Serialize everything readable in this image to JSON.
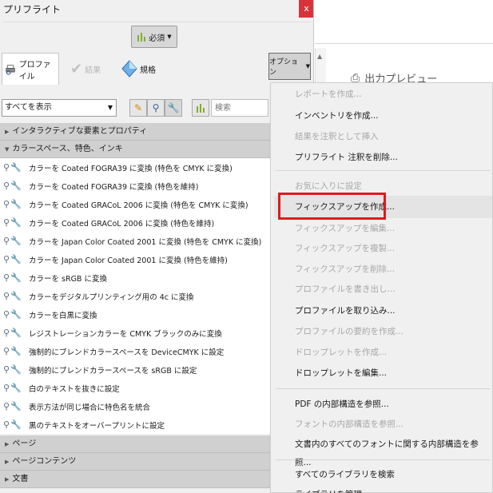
{
  "window": {
    "title": "プリフライト",
    "close_label": "x"
  },
  "toolbar_top": {
    "required_label": "必須"
  },
  "tabs": [
    {
      "label": "プロファイル",
      "icon": "printer-icon",
      "state": "active"
    },
    {
      "label": "結果",
      "icon": "check-icon",
      "state": "disabled"
    },
    {
      "label": "規格",
      "icon": "diamond-icon",
      "state": "normal"
    }
  ],
  "options_label": "オプション",
  "filter": {
    "selected": "すべてを表示"
  },
  "search": {
    "placeholder": "検索"
  },
  "categories": {
    "interactive": "インタラクティブな要素とプロパティ",
    "colorspace": "カラースペース、特色、インキ",
    "page": "ページ",
    "page_contents": "ページコンテンツ",
    "document": "文書"
  },
  "profiles": [
    "カラーを Coated FOGRA39 に変換 (特色を CMYK に変換)",
    "カラーを Coated FOGRA39 に変換 (特色を維持)",
    "カラーを Coated GRACoL 2006 に変換 (特色を CMYK に変換)",
    "カラーを Coated GRACoL 2006 に変換 (特色を維持)",
    "カラーを Japan Color Coated 2001 に変換 (特色を CMYK に変換)",
    "カラーを Japan Color Coated 2001 に変換 (特色を維持)",
    "カラーを sRGB に変換",
    "カラーをデジタルプリンティング用の 4c に変換",
    "カラーを白黒に変換",
    "レジストレーションカラーを CMYK ブラックのみに変換",
    "強制的にブレンドカラースペースを DeviceCMYK に設定",
    "強制的にブレンドカラースペースを sRGB に設定",
    "白のテキストを抜きに設定",
    "表示方法が同じ場合に特色名を統合",
    "黒のテキストをオーバープリントに設定"
  ],
  "preview": {
    "title": "出力プレビュー"
  },
  "menu": {
    "items": [
      {
        "label": "レポートを作成...",
        "enabled": false
      },
      {
        "label": "インベントリを作成...",
        "enabled": true
      },
      {
        "label": "結果を注釈として挿入",
        "enabled": false
      },
      {
        "label": "プリフライト 注釈を削除...",
        "enabled": true
      },
      {
        "label": "お気に入りに設定",
        "enabled": false
      },
      {
        "label": "フィックスアップを作成...",
        "enabled": true
      },
      {
        "label": "フィックスアップを編集...",
        "enabled": false
      },
      {
        "label": "フィックスアップを複製...",
        "enabled": false
      },
      {
        "label": "フィックスアップを削除...",
        "enabled": false
      },
      {
        "label": "プロファイルを書き出し...",
        "enabled": false
      },
      {
        "label": "プロファイルを取り込み...",
        "enabled": true
      },
      {
        "label": "プロファイルの要約を作成...",
        "enabled": false
      },
      {
        "label": "ドロップレットを作成...",
        "enabled": false
      },
      {
        "label": "ドロップレットを編集...",
        "enabled": true
      },
      {
        "label": "PDF の内部構造を参照...",
        "enabled": true
      },
      {
        "label": "フォントの内部構造を参照...",
        "enabled": false
      },
      {
        "label": "文書内のすべてのフォントに関する内部構造を参照...",
        "enabled": true
      },
      {
        "label": "すべてのライブラリを検索",
        "enabled": true
      },
      {
        "label": "ライブラリを管理...",
        "enabled": true
      }
    ]
  },
  "colors": {
    "accent_red": "#e0191e",
    "close_red": "#d9333a"
  }
}
